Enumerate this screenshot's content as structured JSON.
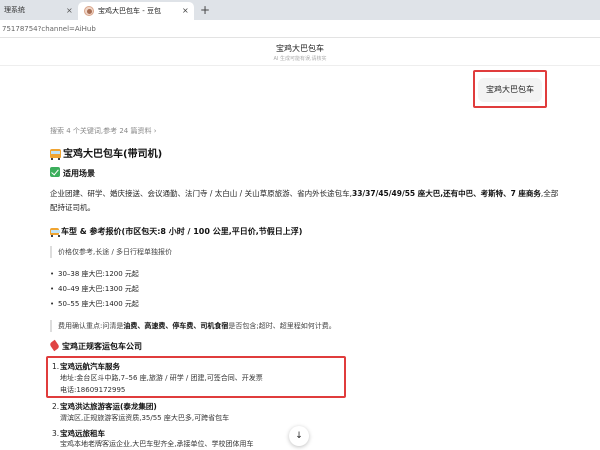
{
  "browser": {
    "prev_tab_title": "理系统",
    "prev_tab_close": "×",
    "active_tab_title": "宝鸡大巴包车 - 豆包",
    "active_tab_close": "×",
    "new_tab": "+",
    "url": "75178754?channel=AiHub"
  },
  "header": {
    "title": "宝鸡大巴包车",
    "subtitle": "AI 生成可能有误,请核实"
  },
  "user_message": "宝鸡大巴包车",
  "search_meta": "搜索 4 个关键词,参考 24 篇资料 ›",
  "answer": {
    "heading": "宝鸡大巴包车(带司机)",
    "scenes_heading": "适用场景",
    "scenes_text": "企业团建、研学、婚庆接送、会议通勤、法门寺 / 太白山 / 关山草原旅游、省内外长途包车,",
    "scenes_bold": "33/37/45/49/55 座大巴,还有中巴、考斯特、7 座商务",
    "scenes_tail": ",全部配持证司机。",
    "pricing_heading": "车型 & 参考报价(市区包天:8 小时 / 100 公里,平日价,节假日上浮)",
    "pricing_note": "价格仅参考,长途 / 多日行程单独报价",
    "prices": [
      "30–38 座大巴:1200 元起",
      "40–49 座大巴:1300 元起",
      "50–55 座大巴:1400 元起"
    ],
    "confirm_prefix": "费用确认重点:问清是",
    "confirm_bold": "油费、高速费、停车费、司机食宿",
    "confirm_tail": "是否包含;超时、超里程如何计费。",
    "companies_heading": "宝鸡正规客运包车公司",
    "companies": [
      {
        "num": "1.",
        "name": "宝鸡远航汽车服务",
        "addr": "地址:金台区斗中路,7–56 座,旅游 / 研学 / 团建,可签合同、开发票",
        "phone": "电话:18609172995"
      },
      {
        "num": "2.",
        "name": "宝鸡洪达旅游客运(泰龙集团)",
        "addr": "渭滨区,正规旅游客运资质,35/55 座大巴多,可跨省包车"
      },
      {
        "num": "3.",
        "name": "宝鸡远旅租车",
        "addr": "宝鸡本地老牌客运企业,大巴车型齐全,承接单位、学校团体用车"
      }
    ]
  },
  "scroll_down": "↓",
  "colors": {
    "highlight_box": "#e03c3c",
    "bus_icon": "#f0a431",
    "check_icon": "#3cae5c",
    "phone_icon": "#e04343"
  }
}
